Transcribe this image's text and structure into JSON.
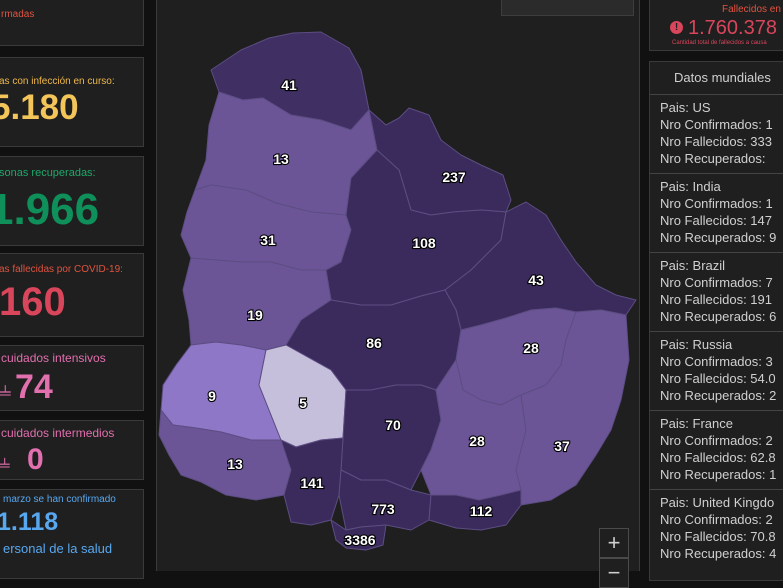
{
  "left_panel": {
    "confirmed_label": "rmadas",
    "active": {
      "label": "as con infección en curso:",
      "value": "5.180"
    },
    "recovered": {
      "label": "sonas recuperadas:",
      "value": "1.966"
    },
    "deceased": {
      "label": "as fallecidas por COVID-19:",
      "value": "160"
    },
    "intensive": {
      "label": "cuidados intensivos",
      "value": "74"
    },
    "intermediate": {
      "label": "cuidados intermedios",
      "value": "0"
    },
    "health_workers": {
      "label1": "marzo se han confirmado",
      "value": "1.118",
      "label2": "ersonal de la salud"
    }
  },
  "map": {
    "departments": [
      {
        "id": "artigas",
        "count": "41",
        "color": "#3f2f63"
      },
      {
        "id": "salto",
        "count": "13",
        "color": "#6b5597"
      },
      {
        "id": "rivera",
        "count": "237",
        "color": "#3b2b5c"
      },
      {
        "id": "paysandu",
        "count": "31",
        "color": "#6b5597"
      },
      {
        "id": "tacuarembo",
        "count": "108",
        "color": "#3b2b5c"
      },
      {
        "id": "rio-negro",
        "count": "19",
        "color": "#6b5597"
      },
      {
        "id": "cerro-largo",
        "count": "43",
        "color": "#3b2b5c"
      },
      {
        "id": "durazno",
        "count": "86",
        "color": "#3b2b5c"
      },
      {
        "id": "soriano",
        "count": "9",
        "color": "#8f77c7"
      },
      {
        "id": "flores",
        "count": "5",
        "color": "#c6bfdc"
      },
      {
        "id": "treinta-y-tres",
        "count": "28",
        "color": "#6b5597"
      },
      {
        "id": "florida",
        "count": "70",
        "color": "#3b2b5c"
      },
      {
        "id": "lavalleja",
        "count": "28",
        "color": "#6b5597"
      },
      {
        "id": "rocha",
        "count": "37",
        "color": "#6b5597"
      },
      {
        "id": "colonia",
        "count": "13",
        "color": "#6b5597"
      },
      {
        "id": "san-jose",
        "count": "141",
        "color": "#3b2b5c"
      },
      {
        "id": "canelones",
        "count": "773",
        "color": "#3b2b5c"
      },
      {
        "id": "maldonado",
        "count": "112",
        "color": "#3b2b5c"
      },
      {
        "id": "montevideo",
        "count": "3386",
        "color": "#3b2b5c"
      }
    ],
    "zoom_in": "+",
    "zoom_out": "−"
  },
  "right_panel": {
    "deaths_header": "Fallecidos en",
    "deaths_value": "1.760.378",
    "deaths_caption": "Cantidad total de fallecidos a causa",
    "world_title": "Datos mundiales",
    "countries": [
      {
        "pais_label": "Pais:",
        "name": "US",
        "confirmed": "Nro Confirmados: 1",
        "deaths": "Nro Fallecidos: 333",
        "recovered": "Nro Recuperados:"
      },
      {
        "pais_label": "Pais:",
        "name": "India",
        "confirmed": "Nro Confirmados: 1",
        "deaths": "Nro Fallecidos: 147",
        "recovered": "Nro Recuperados: 9"
      },
      {
        "pais_label": "Pais:",
        "name": "Brazil",
        "confirmed": "Nro Confirmados: 7",
        "deaths": "Nro Fallecidos: 191",
        "recovered": "Nro Recuperados: 6"
      },
      {
        "pais_label": "Pais:",
        "name": "Russia",
        "confirmed": "Nro Confirmados: 3",
        "deaths": "Nro Fallecidos: 54.0",
        "recovered": "Nro Recuperados: 2"
      },
      {
        "pais_label": "Pais:",
        "name": "France",
        "confirmed": "Nro Confirmados: 2",
        "deaths": "Nro Fallecidos: 62.8",
        "recovered": "Nro Recuperados: 1"
      },
      {
        "pais_label": "Pais:",
        "name": "United Kingdo",
        "confirmed": "Nro Confirmados: 2",
        "deaths": "Nro Fallecidos: 70.8",
        "recovered": "Nro Recuperados: 4"
      }
    ]
  }
}
